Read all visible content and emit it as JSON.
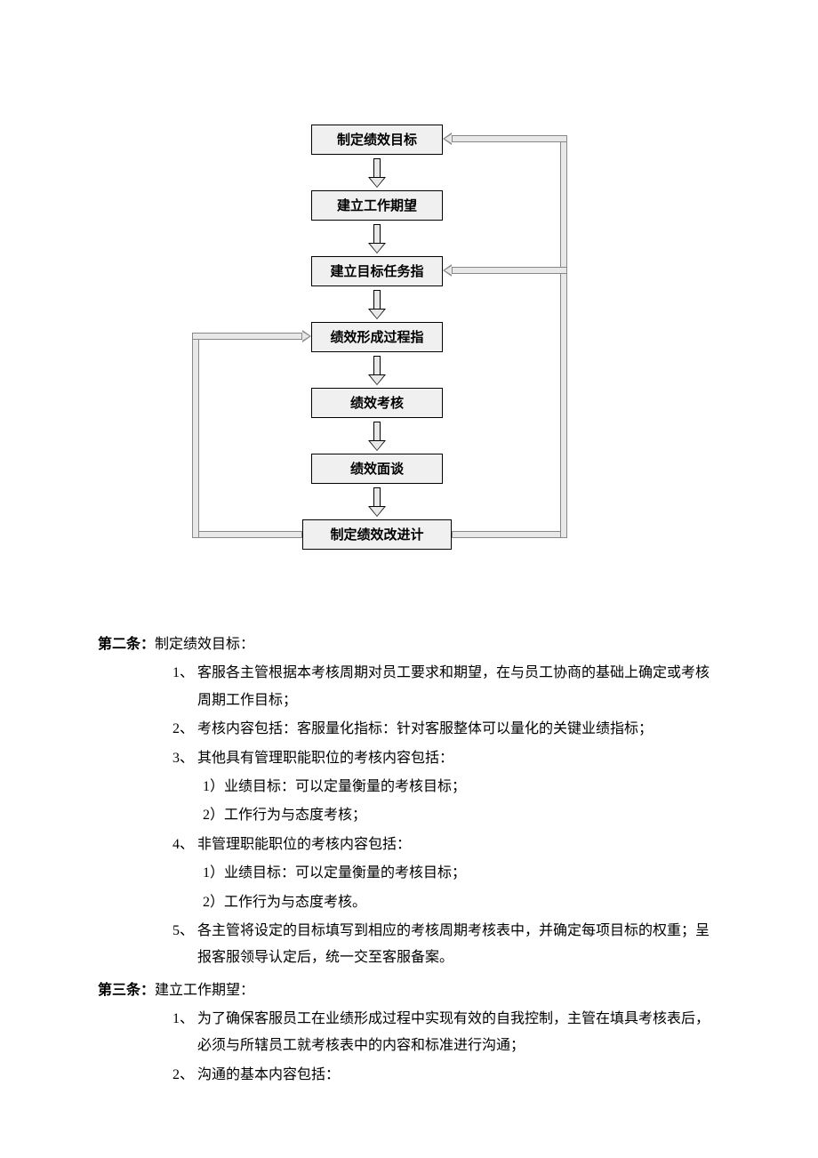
{
  "flow": {
    "nodes": [
      "制定绩效目标",
      "建立工作期望",
      "建立目标任务指",
      "绩效形成过程指",
      "绩效考核",
      "绩效面谈",
      "制定绩效改进计"
    ]
  },
  "clauses": [
    {
      "label": "第二条：",
      "title": "制定绩效目标：",
      "items": [
        {
          "num": "1、",
          "text": "客服各主管根据本考核周期对员工要求和期望，在与员工协商的基础上确定或考核周期工作目标；"
        },
        {
          "num": "2、",
          "text": "考核内容包括：客服量化指标：针对客服整体可以量化的关键业绩指标；"
        },
        {
          "num": "3、",
          "text": "其他具有管理职能职位的考核内容包括：",
          "subs": [
            "1）业绩目标：可以定量衡量的考核目标；",
            "2）工作行为与态度考核；"
          ]
        },
        {
          "num": "4、",
          "text": "非管理职能职位的考核内容包括：",
          "subs": [
            "1）业绩目标：可以定量衡量的考核目标；",
            "2）工作行为与态度考核。"
          ]
        },
        {
          "num": "5、",
          "text": "各主管将设定的目标填写到相应的考核周期考核表中，并确定每项目标的权重；呈报客服领导认定后，统一交至客服备案。"
        }
      ]
    },
    {
      "label": "第三条：",
      "title": "建立工作期望：",
      "items": [
        {
          "num": "1、",
          "text": "为了确保客服员工在业绩形成过程中实现有效的自我控制，主管在填具考核表后，必须与所辖员工就考核表中的内容和标准进行沟通；"
        },
        {
          "num": "2、",
          "text": "沟通的基本内容包括："
        }
      ]
    }
  ]
}
